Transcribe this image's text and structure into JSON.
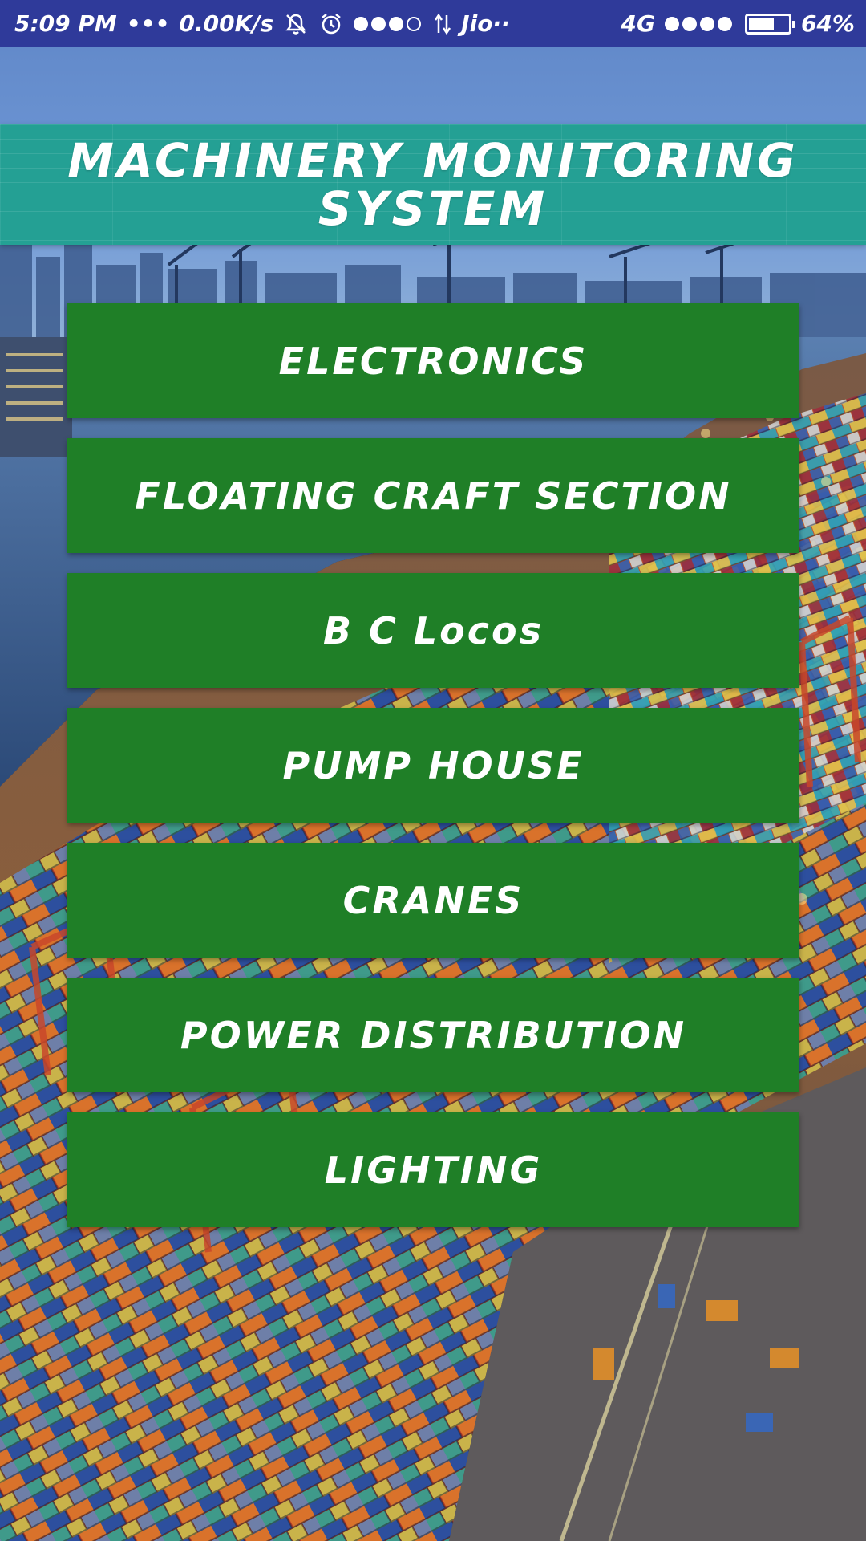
{
  "status_bar": {
    "time": "5:09 PM",
    "more_dots": "•••",
    "net_speed": "0.00K/s",
    "carrier": "Jio",
    "carrier_dots": "··",
    "network_type": "4G",
    "battery_level": 0.64,
    "battery_percent": "64%",
    "icons": [
      "silent-bell-icon",
      "alarm-icon",
      "signal-icon",
      "data-arrows-icon",
      "battery-icon"
    ]
  },
  "header": {
    "title": "MACHINERY MONITORING SYSTEM"
  },
  "menu": {
    "items": [
      {
        "label": "ELECTRONICS"
      },
      {
        "label": "FLOATING CRAFT SECTION"
      },
      {
        "label": "B C Locos"
      },
      {
        "label": "PUMP HOUSE"
      },
      {
        "label": "CRANES"
      },
      {
        "label": "POWER DISTRIBUTION"
      },
      {
        "label": "LIGHTING"
      }
    ]
  },
  "colors": {
    "status_bar": "#2f3a9a",
    "header": "#24a094",
    "button": "#1f7f27",
    "text": "#ffffff"
  },
  "background": {
    "icon": "container-port-image"
  }
}
